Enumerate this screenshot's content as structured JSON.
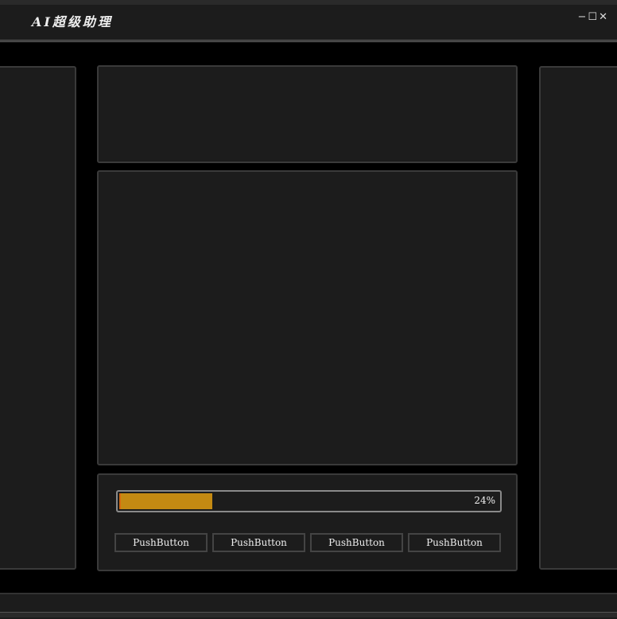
{
  "window": {
    "title": "AI超级助理",
    "minimize": "−",
    "maximize": "☐",
    "close": "✕"
  },
  "progress": {
    "value": 24,
    "label": "24%",
    "color": "#c48a12"
  },
  "buttons": [
    {
      "label": "PushButton"
    },
    {
      "label": "PushButton"
    },
    {
      "label": "PushButton"
    },
    {
      "label": "PushButton"
    }
  ]
}
